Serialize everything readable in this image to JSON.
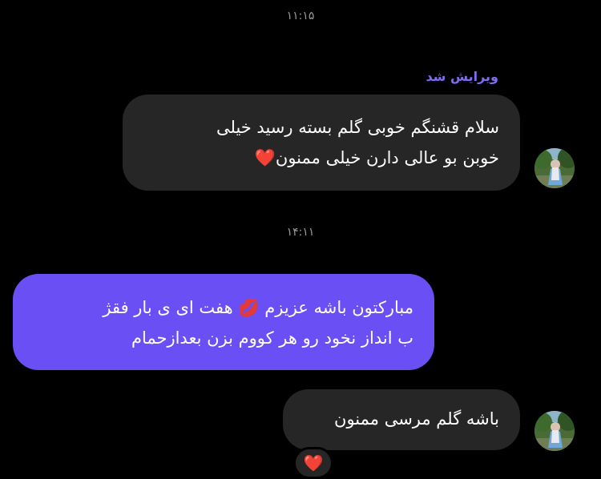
{
  "chat": {
    "timestamp_1": "۱۱:۱۵",
    "edited_label": "ویرایش شد",
    "message_1": {
      "line_1": "سلام قشنگم خوبی گلم بسته رسید خیلی",
      "line_2": "خوبن بو عالی دارن خیلی ممنون",
      "emoji": "❤️"
    },
    "timestamp_2": "۱۴:۱۱",
    "message_2": {
      "line_1_a": "مبارکتون باشه عزیزم",
      "emoji": "💋",
      "line_1_b": "هفت ای ی بار فقژ",
      "line_2": "ب انداز نخود رو هر کووم بزن بعدازحمام"
    },
    "message_3": {
      "text": "باشه گلم مرسی ممنون"
    },
    "reaction": "❤️"
  },
  "icons": {
    "avatar": "profile-avatar",
    "heart": "heart-icon",
    "kiss": "kiss-mark-icon"
  },
  "colors": {
    "background": "#000000",
    "received_bubble": "#262626",
    "sent_bubble": "#6a4ff5",
    "edited_label": "#7f6cf0",
    "timestamp": "#9a9a9a"
  }
}
